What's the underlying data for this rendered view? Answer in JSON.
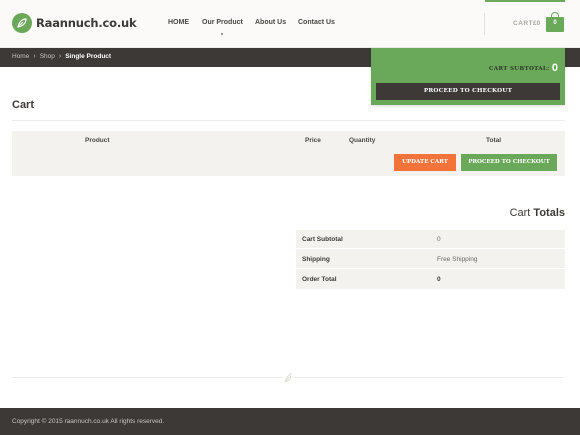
{
  "header": {
    "logo_text": "Raannuch.co.uk",
    "nav": [
      {
        "label": "HOME"
      },
      {
        "label": "Our Product"
      },
      {
        "label": "About Us"
      },
      {
        "label": "Contact Us"
      }
    ],
    "cart_label": "CART",
    "cart_price": "£0",
    "cart_count": "0",
    "accent": "#6aa85a"
  },
  "breadcrumb": {
    "home": "Home",
    "shop": "Shop",
    "current": "Single Product"
  },
  "minicart": {
    "subtotal_label": "CART SUBTOTAL:",
    "subtotal_value": "0",
    "checkout_button": "PROCEED TO CHECKOUT"
  },
  "cart": {
    "title": "Cart",
    "columns": {
      "product": "Product",
      "price": "Price",
      "quantity": "Quantity",
      "total": "Total"
    },
    "update_button": "UPDATE CART",
    "proceed_button": "PROCEED TO CHECKOUT"
  },
  "totals": {
    "title_light": "Cart",
    "title_bold": "Totals",
    "rows": [
      {
        "label": "Cart Subtotal",
        "value": "0"
      },
      {
        "label": "Shipping",
        "value": "Free Shipping"
      },
      {
        "label": "Order Total",
        "value": "0"
      }
    ]
  },
  "footer": {
    "copyright": "Copyright © 2015 raannuch.co.uk All rights reserved."
  },
  "colors": {
    "green": "#6aa85a",
    "orange": "#f4733a",
    "dark": "#3d3937",
    "panel": "#f4f2ee"
  }
}
